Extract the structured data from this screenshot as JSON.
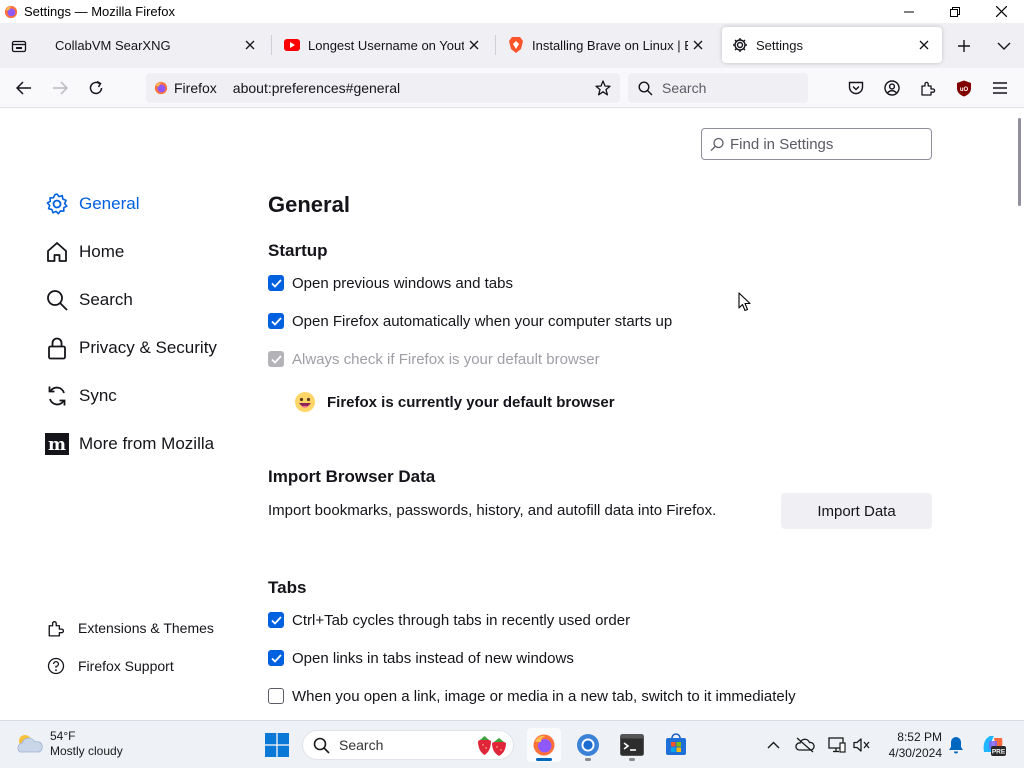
{
  "window": {
    "title": "Settings — Mozilla Firefox"
  },
  "tabs": [
    {
      "label": "CollabVM SearXNG",
      "icon": "none",
      "selected": false
    },
    {
      "label": "Longest Username on Youtube",
      "icon": "youtube-icon",
      "selected": false
    },
    {
      "label": "Installing Brave on Linux | Brave",
      "icon": "brave-icon",
      "selected": false
    },
    {
      "label": "Settings",
      "icon": "gear-icon",
      "selected": true
    }
  ],
  "navbar": {
    "identity_label": "Firefox",
    "url": "about:preferences#general",
    "search_placeholder": "Search"
  },
  "settings": {
    "find_placeholder": "Find in Settings",
    "categories": [
      {
        "label": "General",
        "icon": "gear-icon",
        "selected": true
      },
      {
        "label": "Home",
        "icon": "home-icon",
        "selected": false
      },
      {
        "label": "Search",
        "icon": "search-icon",
        "selected": false
      },
      {
        "label": "Privacy & Security",
        "icon": "lock-icon",
        "selected": false
      },
      {
        "label": "Sync",
        "icon": "sync-icon",
        "selected": false
      },
      {
        "label": "More from Mozilla",
        "icon": "mozilla-icon",
        "selected": false
      }
    ],
    "footer_links": [
      {
        "label": "Extensions & Themes",
        "icon": "puzzle-icon"
      },
      {
        "label": "Firefox Support",
        "icon": "help-icon"
      }
    ],
    "page_title": "General",
    "startup": {
      "heading": "Startup",
      "options": [
        {
          "label": "Open previous windows and tabs",
          "checked": true,
          "disabled": false
        },
        {
          "label": "Open Firefox automatically when your computer starts up",
          "checked": true,
          "disabled": false
        },
        {
          "label": "Always check if Firefox is your default browser",
          "checked": true,
          "disabled": true
        }
      ],
      "default_status": "Firefox is currently your default browser"
    },
    "import": {
      "heading": "Import Browser Data",
      "description": "Import bookmarks, passwords, history, and autofill data into Firefox.",
      "button_label": "Import Data"
    },
    "tabs_section": {
      "heading": "Tabs",
      "options": [
        {
          "label": "Ctrl+Tab cycles through tabs in recently used order",
          "checked": true
        },
        {
          "label": "Open links in tabs instead of new windows",
          "checked": true
        },
        {
          "label": "When you open a link, image or media in a new tab, switch to it immediately",
          "checked": false
        }
      ]
    }
  },
  "taskbar": {
    "weather_temp": "54°F",
    "weather_desc": "Mostly cloudy",
    "search_label": "Search",
    "time": "8:52 PM",
    "date": "4/30/2024"
  },
  "colors": {
    "accent": "#0061e0",
    "taskbar_accent": "#0067c0"
  }
}
